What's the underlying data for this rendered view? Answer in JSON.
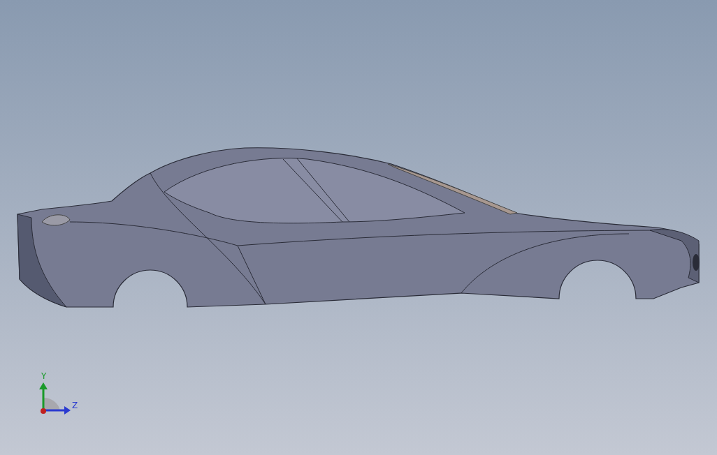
{
  "triad": {
    "labels": [
      "Y",
      "Z"
    ]
  }
}
